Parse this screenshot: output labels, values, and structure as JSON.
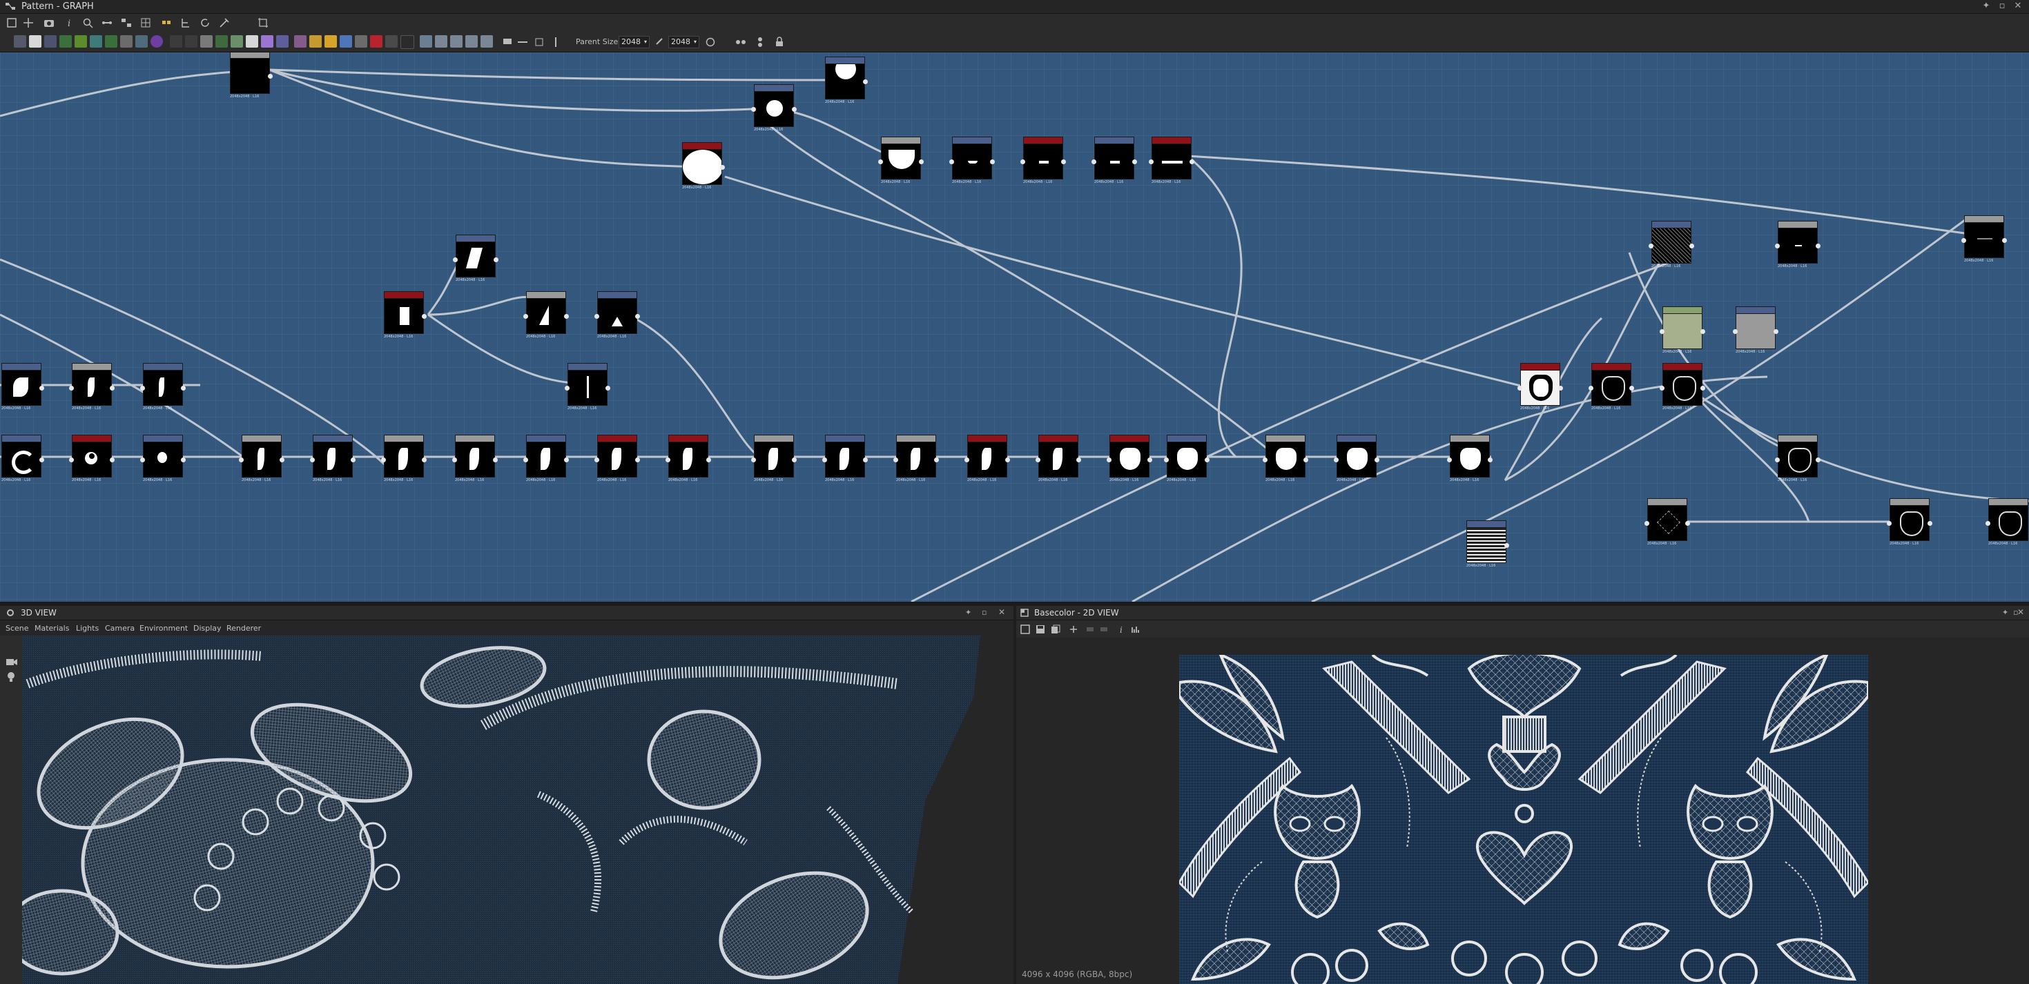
{
  "window": {
    "title": "Pattern - GRAPH"
  },
  "toolbar": {
    "parent_size_label": "Parent Size:",
    "parent_size_value": "2048",
    "size_value": "2048"
  },
  "panels": {
    "view3d_title": "3D VIEW",
    "view2d_title": "Basecolor - 2D VIEW",
    "view3d_menu": [
      "Scene",
      "Materials",
      "Lights",
      "Camera",
      "Environment",
      "Display",
      "Renderer"
    ],
    "view2d_status": "4096 x 4096 (RGBA, 8bpc)"
  },
  "colors": {
    "graph_bg": "#34577d",
    "node_header_red": "#8e1218",
    "node_header_blue": "#4a5f8c",
    "link": "#cfd3d8",
    "fabric": "#1d3550",
    "lace": "#e6e6e6"
  },
  "icons": [
    "graph-icon",
    "pin-icon",
    "maximize-icon",
    "close-icon",
    "camera-icon",
    "light-icon",
    "save-icon",
    "info-icon",
    "histogram-icon"
  ]
}
